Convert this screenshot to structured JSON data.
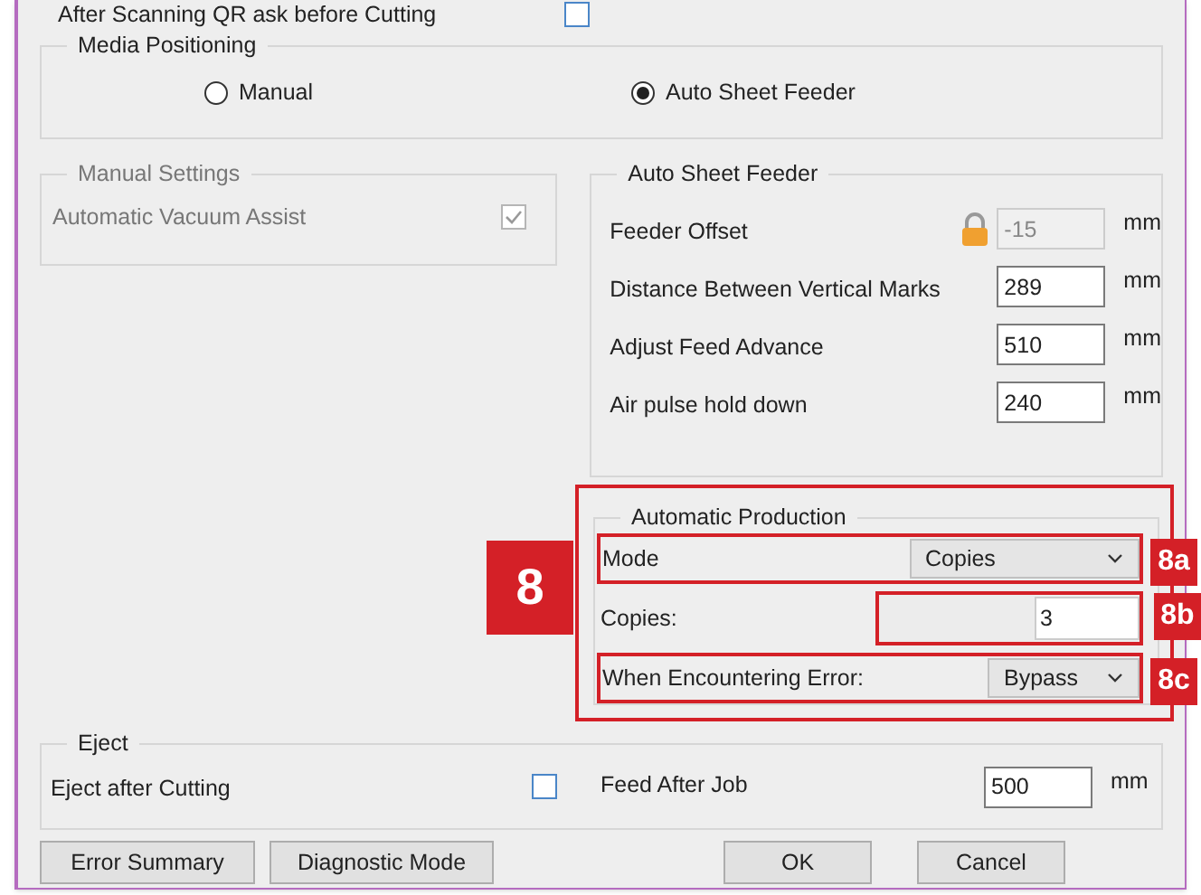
{
  "top_option": {
    "label": "After Scanning QR ask before Cutting",
    "checked": false
  },
  "media_positioning": {
    "title": "Media Positioning",
    "options": [
      {
        "label": "Manual",
        "selected": false
      },
      {
        "label": "Auto Sheet Feeder",
        "selected": true
      }
    ]
  },
  "manual_settings": {
    "title": "Manual Settings",
    "disabled": true,
    "options": [
      {
        "label": "Automatic Vacuum Assist",
        "checked": true
      }
    ]
  },
  "auto_sheet_feeder": {
    "title": "Auto Sheet Feeder",
    "fields": [
      {
        "label": "Feeder Offset",
        "value": "-15",
        "unit": "mm",
        "locked": true
      },
      {
        "label": "Distance Between Vertical Marks",
        "value": "289",
        "unit": "mm",
        "locked": false
      },
      {
        "label": "Adjust Feed Advance",
        "value": "510",
        "unit": "mm",
        "locked": false
      },
      {
        "label": "Air pulse hold down",
        "value": "240",
        "unit": "mm",
        "locked": false
      }
    ]
  },
  "automatic_production": {
    "title": "Automatic Production",
    "callout": "8",
    "rows": [
      {
        "kind": "dropdown",
        "label": "Mode",
        "value": "Copies",
        "callout": "8a"
      },
      {
        "kind": "input",
        "label": "Copies:",
        "value": "3",
        "callout": "8b"
      },
      {
        "kind": "dropdown",
        "label": "When Encountering Error:",
        "value": "Bypass",
        "callout": "8c"
      }
    ]
  },
  "eject": {
    "title": "Eject",
    "option": {
      "label": "Eject after Cutting",
      "checked": false
    },
    "field": {
      "label": "Feed After Job",
      "value": "500",
      "unit": "mm"
    }
  },
  "buttons_left": [
    "Error Summary",
    "Diagnostic Mode"
  ],
  "buttons_right": [
    "OK",
    "Cancel"
  ]
}
